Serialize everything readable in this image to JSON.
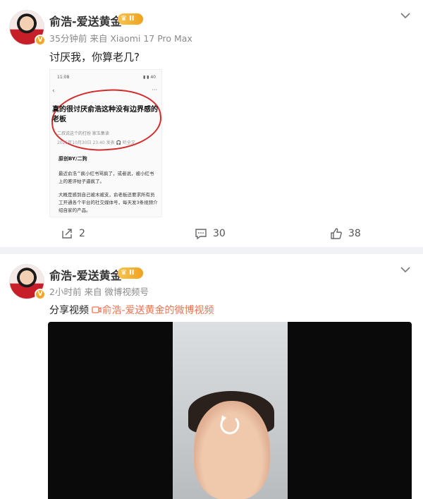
{
  "post1": {
    "author": "俞浩-爱送黄金",
    "level_badge": "II",
    "verified_badge": "V",
    "time": "35分钟前",
    "source": "来自 Xiaomi 17 Pro Max",
    "text": "讨厌我，你算老几?",
    "image": {
      "status_time": "11:08",
      "status_right": "▮ ▮ 40",
      "back": "‹",
      "more": "···",
      "article_title": "真的很讨厌俞浩这种没有边界感的老板",
      "article_author": "二叔说这个的打扮    家玉集读",
      "article_date": "2025年10月30日 23:40    发表    🎧 听全文",
      "byline": "原创BY/二狗",
      "para1": "最近俞浩^疯小红书骂疯了，或者说，被小红书上的差评帖子逼疯了。",
      "para2": "大概是感到自己被木被支，俞老板还要求所有员工开通各个平台的社交媒体号，每天发3条视频介绍自家的产品。"
    },
    "actions": {
      "share_count": "2",
      "comment_count": "30",
      "like_count": "38"
    }
  },
  "post2": {
    "author": "俞浩-爱送黄金",
    "level_badge": "II",
    "verified_badge": "V",
    "time": "2小时前",
    "source": "来自 微博视频号",
    "text_prefix": "分享视频",
    "text_link": "俞浩-爱送黄金的微博视频"
  },
  "icons": {
    "chevron": "chevron-down-icon",
    "share": "share-icon",
    "comment": "comment-icon",
    "like": "like-icon",
    "replay": "replay-icon",
    "video_link": "video-link-icon"
  },
  "colors": {
    "link": "#eb7350",
    "badge_gold": "#f2a62a",
    "separator": "#f1f2f5"
  }
}
